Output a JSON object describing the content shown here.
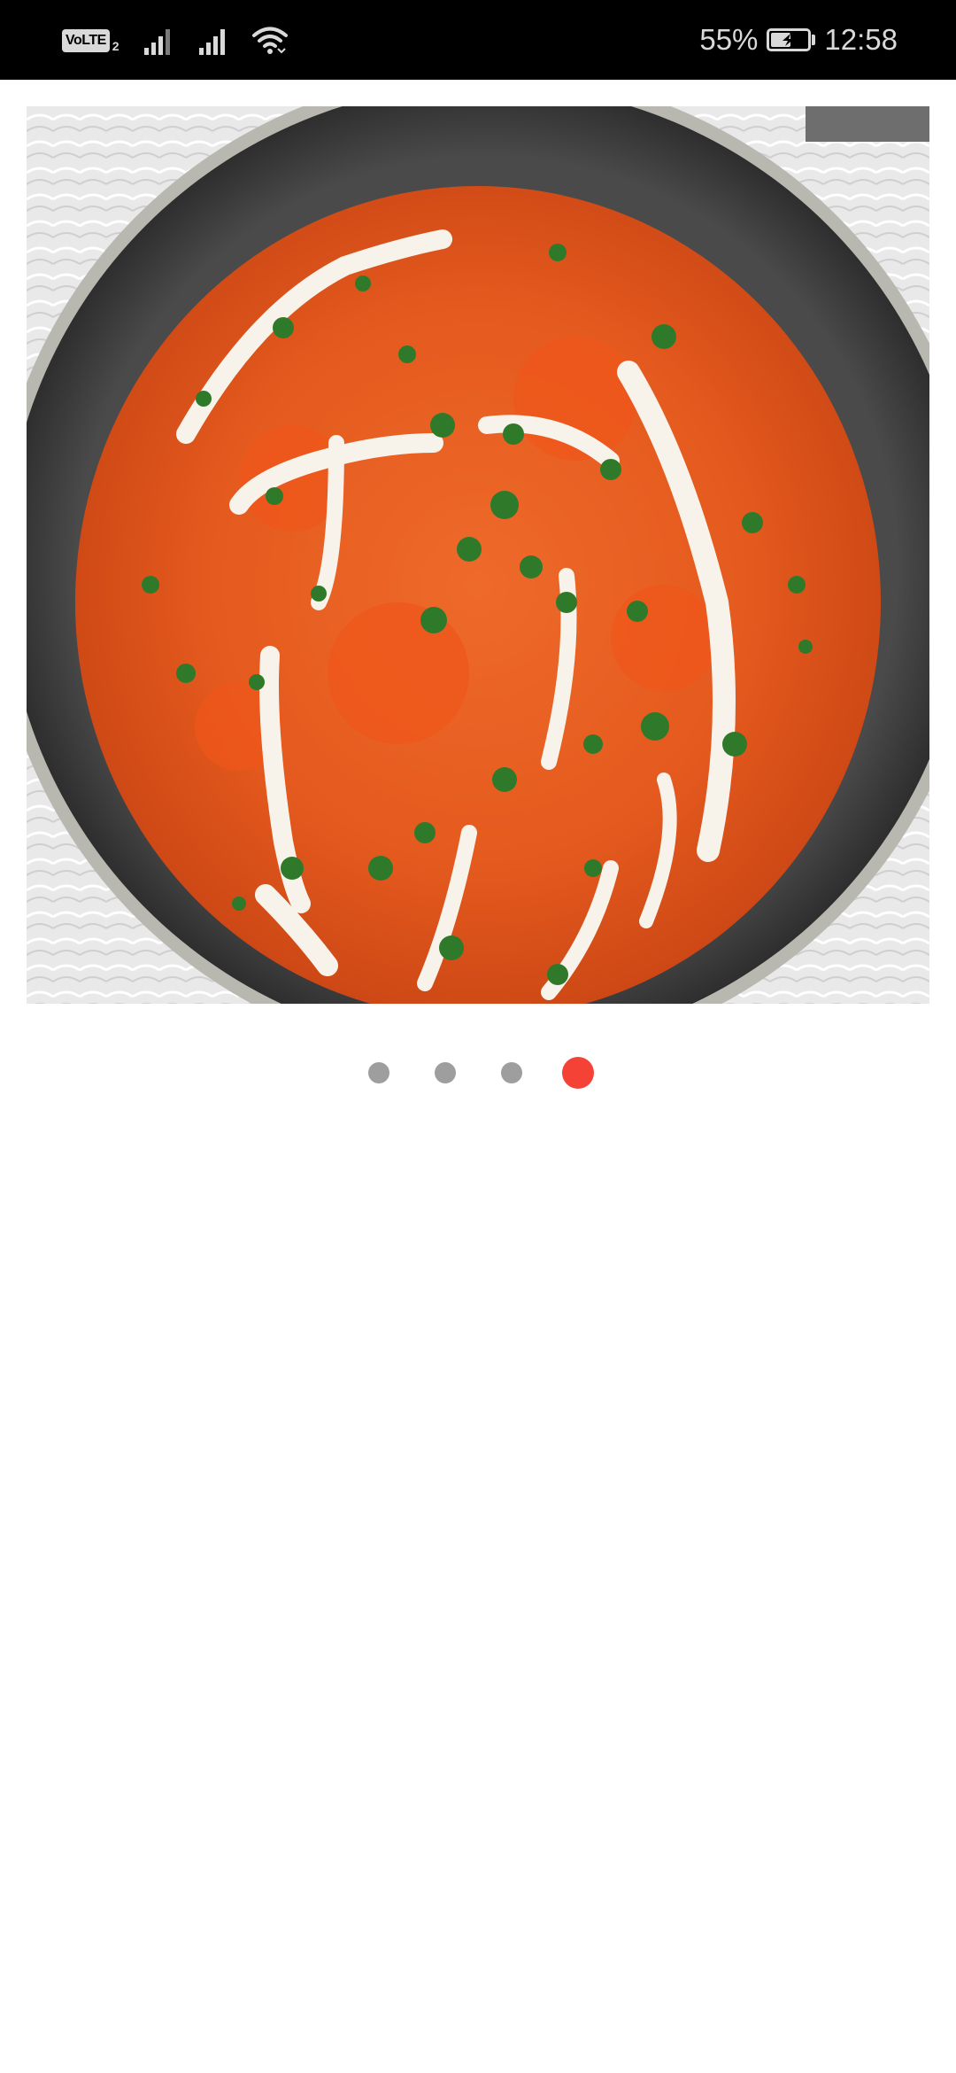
{
  "status_bar": {
    "volte_label": "VoLTE",
    "volte_sim": "2",
    "battery_percent": "55%",
    "battery_level": 0.55,
    "time": "12:58",
    "icons": [
      "signal-icon",
      "signal-icon",
      "wifi-icon",
      "battery-charging-icon"
    ]
  },
  "carousel": {
    "image": "butter-chicken-curry-in-dark-pan",
    "page_count": 4,
    "active_index": 3
  },
  "colors": {
    "active_dot": "#f44336",
    "inactive_dot": "#9e9e9e",
    "status_bar_bg": "#000000",
    "page_bg": "#ffffff"
  }
}
